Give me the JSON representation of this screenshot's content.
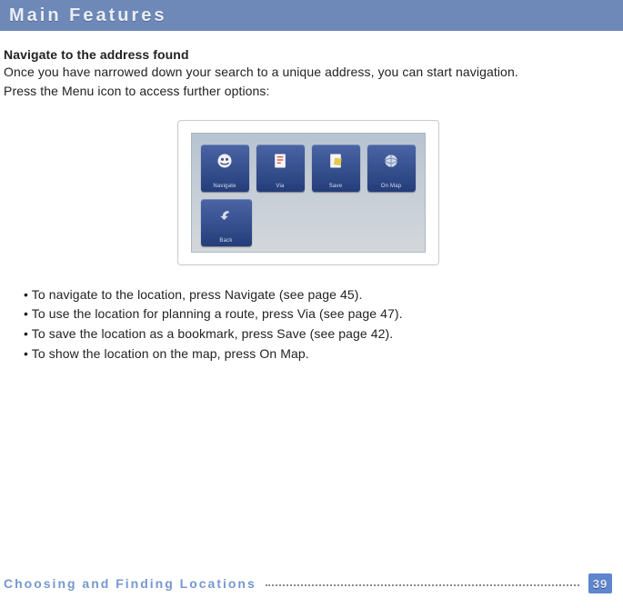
{
  "header": {
    "title": "Main Features"
  },
  "section": {
    "heading": "Navigate to the address found",
    "p1": "Once you have narrowed down your search to a unique address, you can start navigation.",
    "p2": "Press the Menu icon to access further options:"
  },
  "device": {
    "tiles": {
      "navigate": "Navigate",
      "via": "Via",
      "save": "Save",
      "onmap": "On Map",
      "back": "Back"
    }
  },
  "bullets": {
    "b1": "To navigate to the location, press Navigate (see page 45).",
    "b2": "To use the location for planning a route, press Via (see page 47).",
    "b3": "To save the location as a bookmark, press Save (see page 42).",
    "b4": "To show the location on the map, press On Map."
  },
  "footer": {
    "chapter": "Choosing and Finding Locations",
    "page": "39"
  }
}
